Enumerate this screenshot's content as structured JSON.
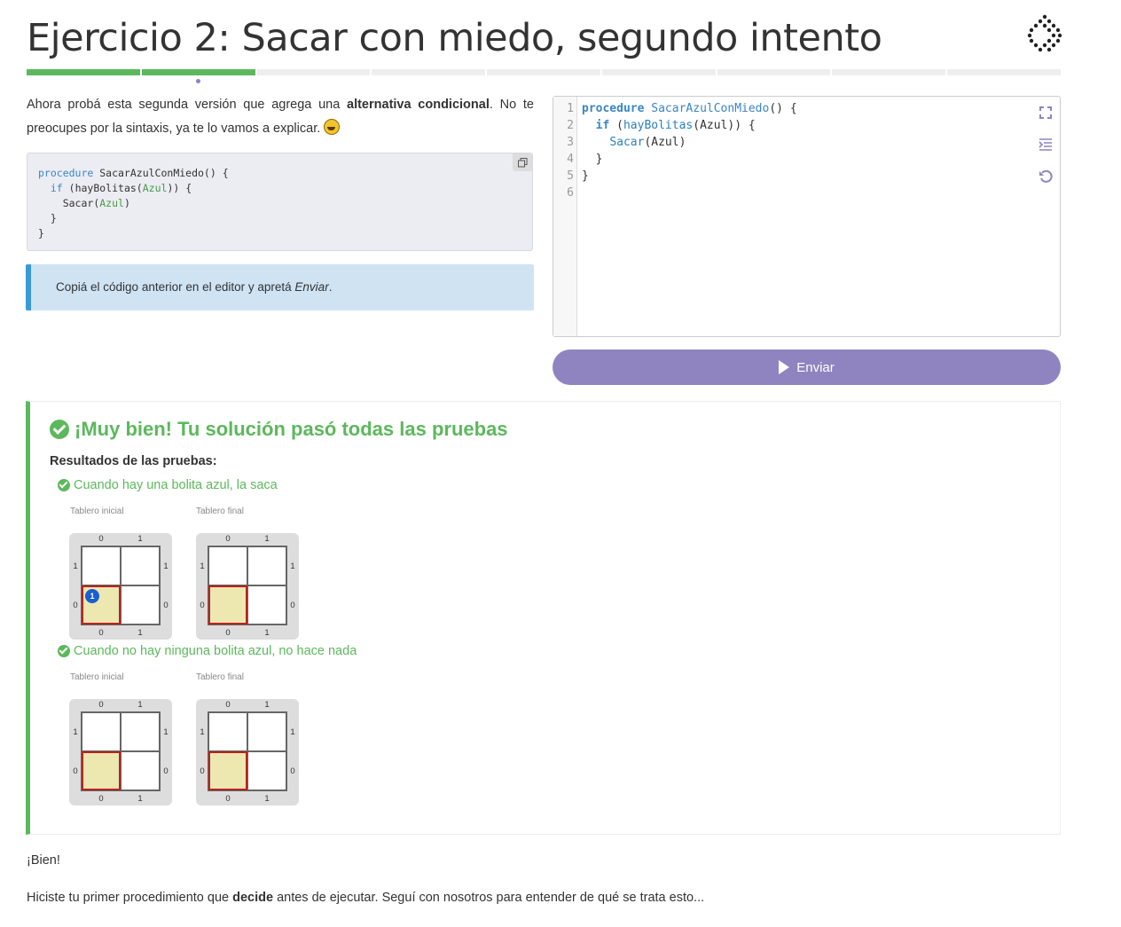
{
  "header": {
    "title": "Ejercicio 2: Sacar con miedo, segundo intento"
  },
  "progress": {
    "total_segments": 9,
    "completed_segments": 2,
    "current_segment": 2
  },
  "intro": {
    "part1": "Ahora probá esta segunda versión que agrega una ",
    "bold": "alternativa condicional",
    "part2": ". No te preocupes por la sintaxis, ya te lo vamos a explicar. ",
    "emoji": "grinning-face"
  },
  "example_code": {
    "l1_kw": "procedure",
    "l1_rest": " SacarAzulConMiedo() {",
    "l2_kw": "if",
    "l2_a": " (hayBolitas(",
    "l2_arg": "Azul",
    "l2_b": ")) {",
    "l3_a": "Sacar(",
    "l3_arg": "Azul",
    "l3_b": ")",
    "l4": "}",
    "l5": "}",
    "copy_icon": "copy-icon"
  },
  "hint": {
    "text_before": "Copiá el código anterior en el editor y apretá ",
    "text_em": "Enviar",
    "text_after": "."
  },
  "editor": {
    "line_numbers": [
      "1",
      "2",
      "3",
      "4",
      "5",
      "6"
    ],
    "l1_kw": "procedure",
    "l1_name": "SacarAzulConMiedo",
    "l1_rest": "() {",
    "l2_kw": "if",
    "l2_a": " (",
    "l2_fn": "hayBolitas",
    "l2_b": "(Azul)) {",
    "l3_fn": "Sacar",
    "l3_b": "(Azul)",
    "l4": "}",
    "l5": "}"
  },
  "submit": {
    "label": "Enviar"
  },
  "results": {
    "title": "¡Muy bien! Tu solución pasó todas las pruebas",
    "subtitle": "Resultados de las pruebas:",
    "tests": [
      {
        "label": "Cuando hay una bolita azul, la saca",
        "initial_caption": "Tablero inicial",
        "final_caption": "Tablero final",
        "initial_blue": "1"
      },
      {
        "label": "Cuando no hay ninguna bolita azul, no hace nada",
        "initial_caption": "Tablero inicial",
        "final_caption": "Tablero final"
      }
    ],
    "axis": {
      "x0": "0",
      "x1": "1",
      "y0": "0",
      "y1": "1"
    }
  },
  "footer": {
    "line1": "¡Bien!",
    "line2_before": "Hiciste tu primer procedimiento que ",
    "line2_bold": "decide",
    "line2_after": " antes de ejecutar. Seguí con nosotros para entender de qué se trata esto..."
  }
}
